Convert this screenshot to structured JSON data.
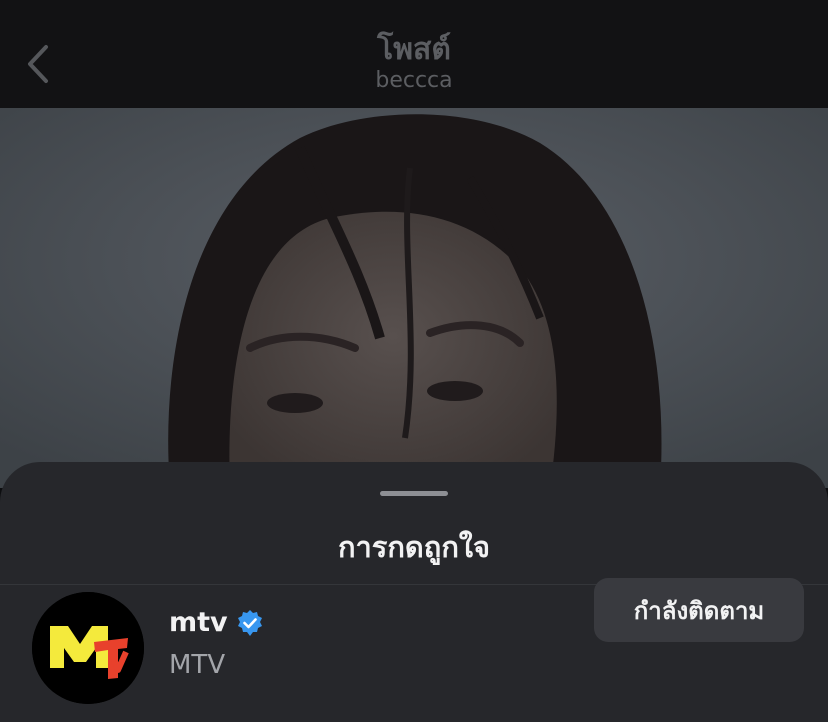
{
  "header": {
    "title": "โพสต์",
    "subtitle": "beccca",
    "back_icon": "chevron-left-icon"
  },
  "sheet": {
    "title": "การกดถูกใจ"
  },
  "likes": [
    {
      "username": "mtv",
      "full_name": "MTV",
      "verified": true,
      "verified_icon": "verified-badge-icon",
      "avatar_logo": "mtv-logo",
      "button_label": "กำลังติดตาม"
    }
  ],
  "colors": {
    "sheet_bg": "#26272b",
    "button_bg": "#393a3f",
    "verified_blue": "#3897f0",
    "mtv_yellow": "#f4ea3c"
  }
}
